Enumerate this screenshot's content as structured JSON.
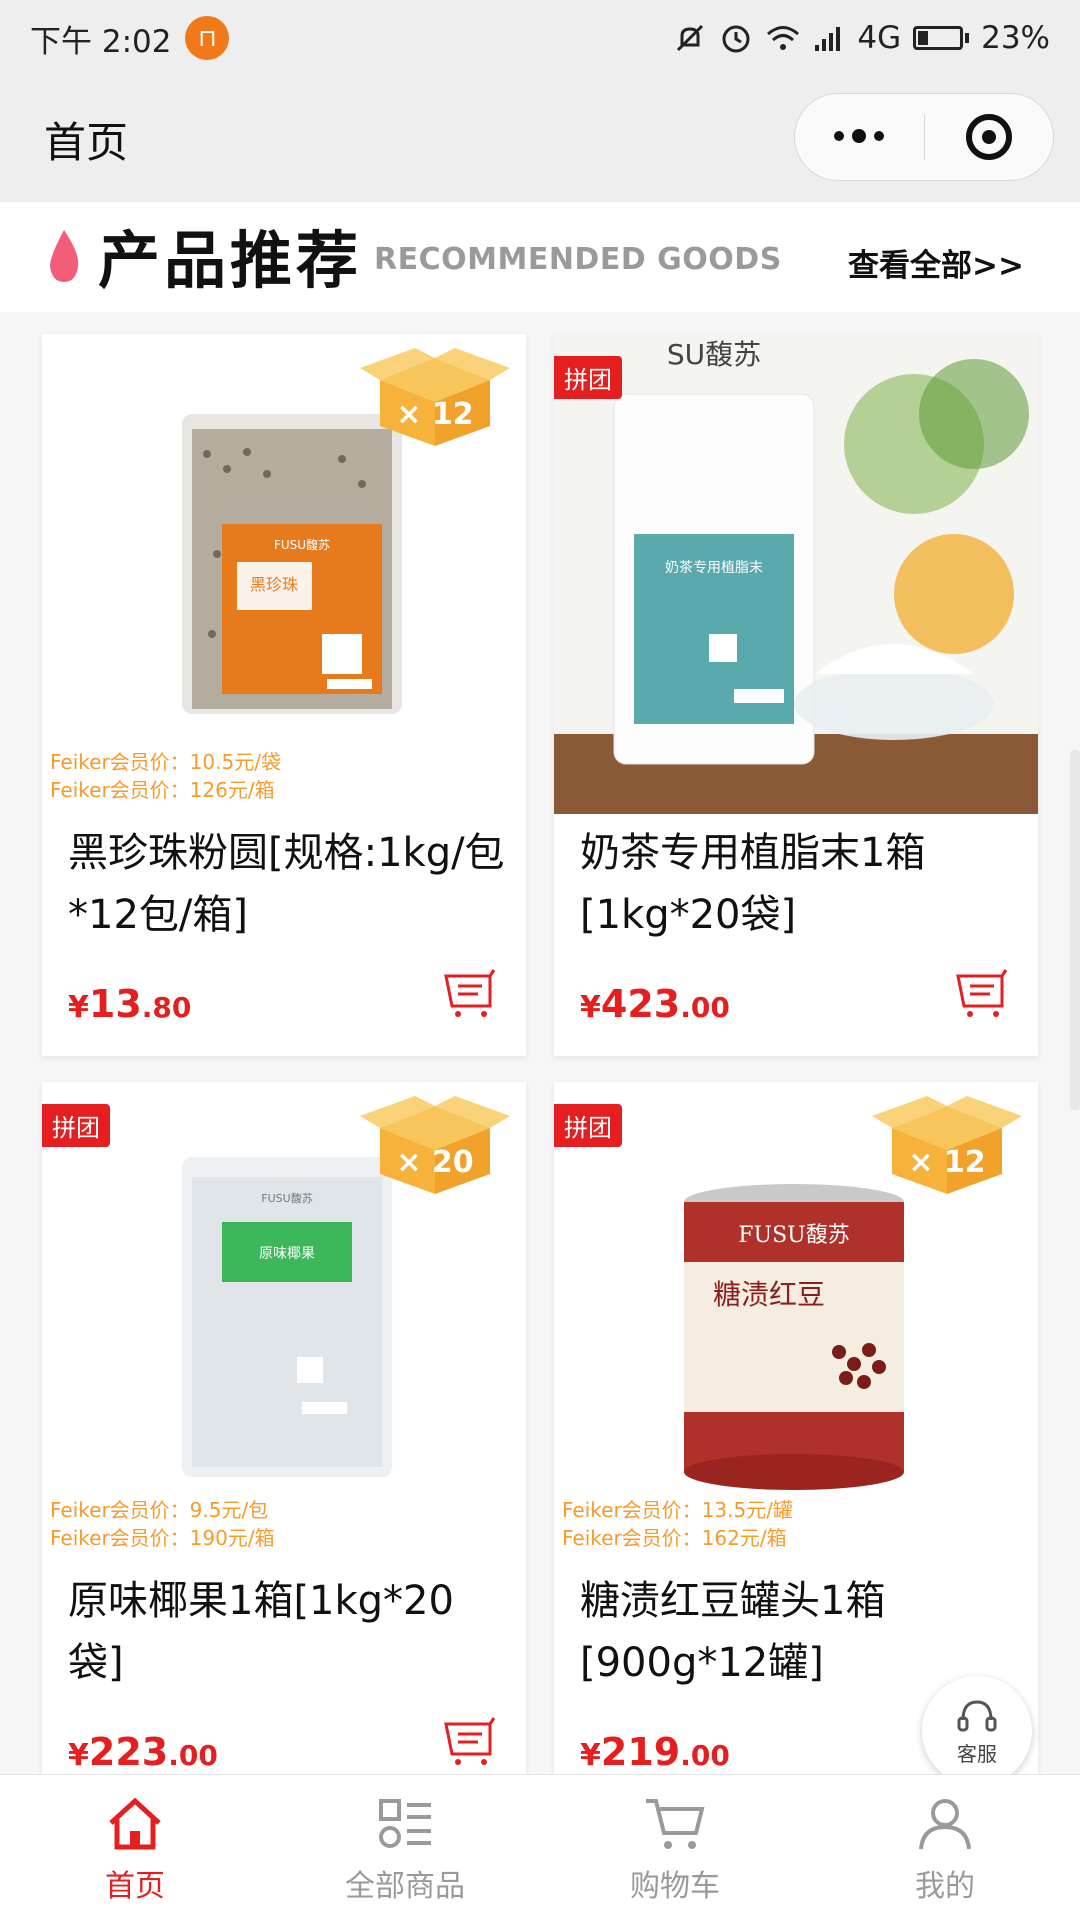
{
  "status_bar": {
    "time": "下午 2:02",
    "network": "4G",
    "battery": "23%"
  },
  "nav": {
    "title": "首页"
  },
  "section": {
    "title": "产品推荐",
    "subtitle": "RECOMMENDED GOODS",
    "view_all": "查看全部>>"
  },
  "products": [
    {
      "name": "黑珍珠粉圆[规格:1kg/包 *12包/箱]",
      "price_symbol": "¥",
      "price_int": "13",
      "price_dec": ".80",
      "badge": "",
      "box_count": "× 12",
      "member_line1": "Feiker会员价：10.5元/袋",
      "member_line2": "Feiker会员价：126元/箱",
      "package_text": "黑珍珠",
      "brand": "FUSU馥苏"
    },
    {
      "name": "奶茶专用植脂末1箱[1kg*20袋]",
      "price_symbol": "¥",
      "price_int": "423",
      "price_dec": ".00",
      "badge": "拼团",
      "box_count": "",
      "member_line1": "",
      "member_line2": "",
      "package_text": "奶茶专用植脂末",
      "brand": "SU馥苏"
    },
    {
      "name": "原味椰果1箱[1kg*20袋]",
      "price_symbol": "¥",
      "price_int": "223",
      "price_dec": ".00",
      "badge": "拼团",
      "box_count": "× 20",
      "member_line1": "Feiker会员价：9.5元/包",
      "member_line2": "Feiker会员价：190元/箱",
      "package_text": "原味椰果",
      "brand": "FUSU馥苏"
    },
    {
      "name": "糖渍红豆罐头1箱[900g*12罐]",
      "price_symbol": "¥",
      "price_int": "219",
      "price_dec": ".00",
      "badge": "拼团",
      "box_count": "× 12",
      "member_line1": "Feiker会员价：13.5元/罐",
      "member_line2": "Feiker会员价：162元/箱",
      "package_text": "糖渍红豆",
      "brand": "FUSU馥苏"
    }
  ],
  "float_service": {
    "label": "客服"
  },
  "tabs": [
    {
      "label": "首页",
      "icon": "home-icon",
      "active": true
    },
    {
      "label": "全部商品",
      "icon": "category-icon",
      "active": false
    },
    {
      "label": "购物车",
      "icon": "cart-icon",
      "active": false
    },
    {
      "label": "我的",
      "icon": "user-icon",
      "active": false
    }
  ],
  "colors": {
    "accent": "#e51f1f",
    "member_price": "#f59b2a",
    "box_badge": "#f6b23a"
  }
}
